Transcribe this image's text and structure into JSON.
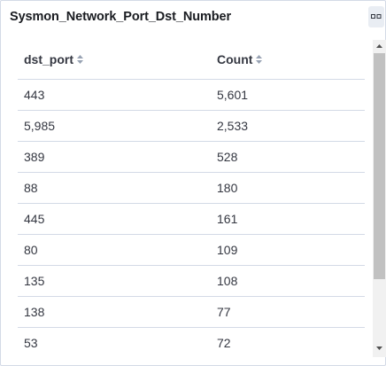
{
  "panel": {
    "title": "Sysmon_Network_Port_Dst_Number",
    "options_icon": "panel-options-icon"
  },
  "table": {
    "columns": [
      {
        "label": "dst_port",
        "sort_icon": "sort-icon"
      },
      {
        "label": "Count",
        "sort_icon": "sort-icon"
      }
    ],
    "rows": [
      {
        "dst_port": "443",
        "count": "5,601"
      },
      {
        "dst_port": "5,985",
        "count": "2,533"
      },
      {
        "dst_port": "389",
        "count": "528"
      },
      {
        "dst_port": "88",
        "count": "180"
      },
      {
        "dst_port": "445",
        "count": "161"
      },
      {
        "dst_port": "80",
        "count": "109"
      },
      {
        "dst_port": "135",
        "count": "108"
      },
      {
        "dst_port": "138",
        "count": "77"
      },
      {
        "dst_port": "53",
        "count": "72"
      }
    ]
  },
  "colors": {
    "border": "#d3dae6",
    "text": "#343741",
    "title": "#1a1c21",
    "scroll_thumb": "#c1c1c1"
  }
}
